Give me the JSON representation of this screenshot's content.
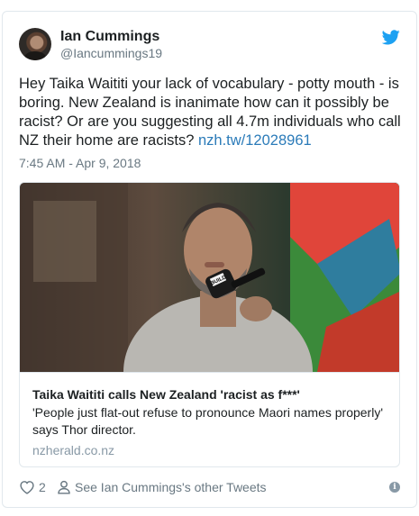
{
  "author": {
    "name": "Ian Cummings",
    "handle": "@Iancummings19"
  },
  "tweet": {
    "text": "Hey Taika Waititi your lack of vocabulary - potty mouth - is boring. New Zealand is inanimate how can it possibly be racist? Or are you suggesting all 4.7m individuals who call NZ their home are racists? ",
    "link": "nzh.tw/12028961",
    "timestamp": "7:45 AM - Apr 9, 2018"
  },
  "card": {
    "mic_label": "BUILD",
    "title": "Taika Waititi calls New Zealand 'racist as f***'",
    "description": "'People just flat-out refuse to pronounce Maori names properly' says Thor director.",
    "domain": "nzherald.co.nz"
  },
  "footer": {
    "like_count": "2",
    "other_tweets_label": "See Ian Cummings's other Tweets",
    "info_label": "i"
  },
  "colors": {
    "twitter_blue": "#1da1f2",
    "link": "#2b7bb9",
    "secondary_text": "#697882"
  },
  "icons": [
    "twitter-bird-icon",
    "heart-icon",
    "person-icon",
    "info-icon"
  ]
}
